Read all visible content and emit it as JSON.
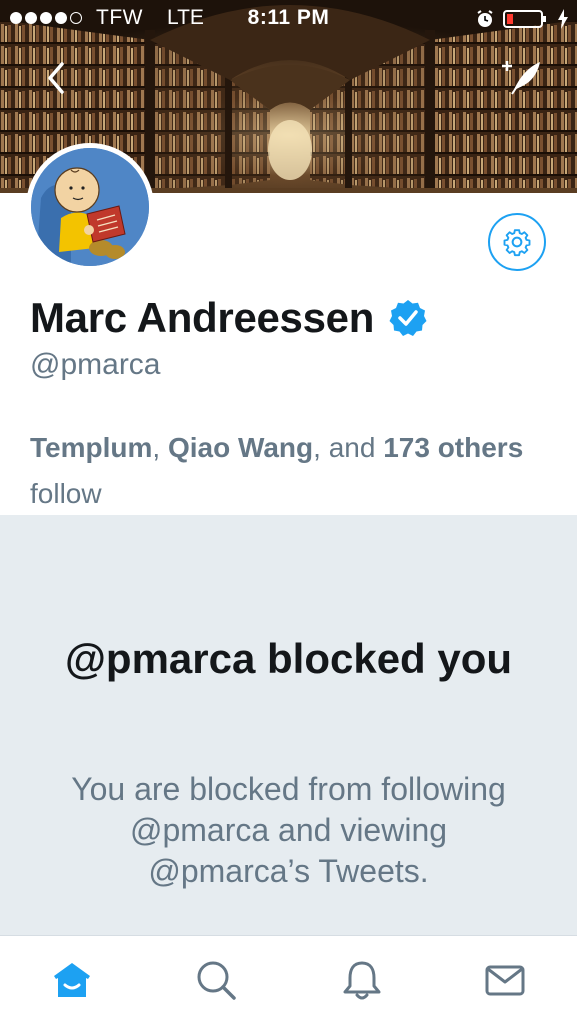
{
  "status_bar": {
    "carrier": "TFW",
    "network": "LTE",
    "time": "8:11 PM"
  },
  "profile": {
    "name": "Marc Andreessen",
    "handle": "@pmarca",
    "verified": true,
    "followers_line": {
      "name1": "Templum",
      "sep1": ", ",
      "name2": "Qiao Wang",
      "sep2": ", and ",
      "count": "173",
      "others": "others",
      "suffix": " follow"
    }
  },
  "blocked": {
    "title": "@pmarca blocked you",
    "description": "You are blocked from following @pmarca and viewing @pmarca’s Tweets."
  },
  "tabs": [
    {
      "name": "home",
      "icon": "home-icon",
      "active": true
    },
    {
      "name": "search",
      "icon": "search-icon",
      "active": false
    },
    {
      "name": "notifications",
      "icon": "bell-icon",
      "active": false
    },
    {
      "name": "messages",
      "icon": "envelope-icon",
      "active": false
    }
  ],
  "colors": {
    "accent": "#1da1f2",
    "text_primary": "#14171a",
    "text_secondary": "#657786",
    "panel_background": "#e6ecf0"
  }
}
